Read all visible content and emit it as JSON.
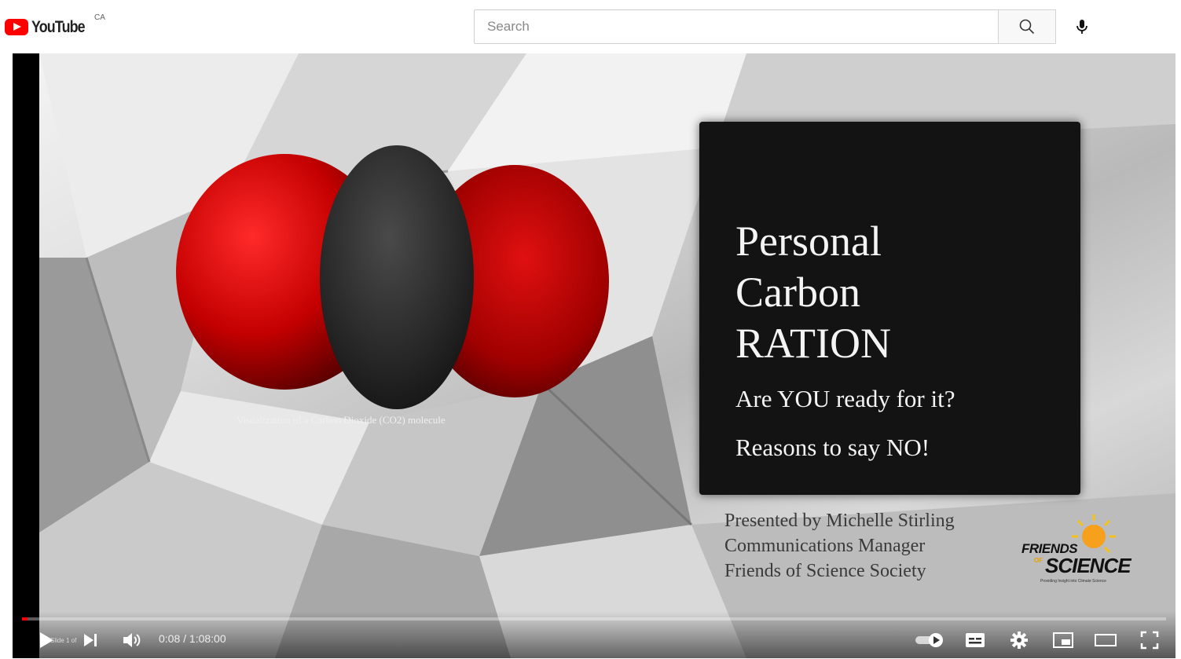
{
  "header": {
    "logo_text": "YouTube",
    "country_code": "CA",
    "search_placeholder": "Search",
    "search_icon": "search-icon",
    "mic_icon": "microphone-icon"
  },
  "slide": {
    "caption": "Visualization of a Carbon Dioxide (CO2) molecule",
    "title_lines": [
      "Personal",
      "Carbon",
      "RATION"
    ],
    "question": "Are YOU ready for it?",
    "reasons": "Reasons to say NO!",
    "presenter_lines": [
      "Presented by Michelle Stirling",
      "Communications Manager",
      "Friends of Science Society"
    ],
    "logo": {
      "friends": "FRIENDS",
      "of": "OF",
      "science": "SCIENCE",
      "tagline": "Providing Insight into Climate Science"
    },
    "colors": {
      "oxygen": "#d40000",
      "carbon": "#2b2b2b",
      "card": "#131313"
    }
  },
  "player": {
    "current_time": "0:08",
    "duration": "1:08:00",
    "time_display": "0:08 / 1:08:00",
    "progress_fraction": 0.002,
    "chapter_hint": "Slide 1 of",
    "accent_color": "#ff0000",
    "controls": {
      "play_icon": "play-icon",
      "next_icon": "next-icon",
      "volume_icon": "volume-icon",
      "autoplay_icon": "autoplay-toggle-icon",
      "subtitles_icon": "subtitles-icon",
      "settings_icon": "settings-gear-icon",
      "miniplayer_icon": "miniplayer-icon",
      "theater_icon": "theater-mode-icon",
      "fullscreen_icon": "fullscreen-icon"
    }
  }
}
